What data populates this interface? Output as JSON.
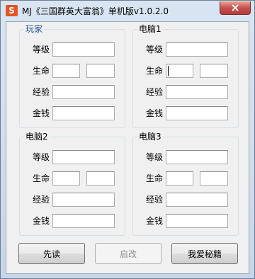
{
  "window": {
    "title": "MJ《三国群英大富翁》单机版v1.0.2.0",
    "icon": "app-logo-icon",
    "close_icon": "close-icon"
  },
  "labels": {
    "level": "等级",
    "life": "生命",
    "exp": "经验",
    "money": "金钱"
  },
  "groups": [
    {
      "title": "玩家"
    },
    {
      "title": "电脑1"
    },
    {
      "title": "电脑2"
    },
    {
      "title": "电脑3"
    }
  ],
  "fields": {
    "player": {
      "level": "",
      "life_current": "",
      "life_max": "",
      "exp": "",
      "money": ""
    },
    "computer1": {
      "level": "",
      "life_current": "",
      "life_max": "",
      "exp": "",
      "money": ""
    },
    "computer2": {
      "level": "",
      "life_current": "",
      "life_max": "",
      "exp": "",
      "money": ""
    },
    "computer3": {
      "level": "",
      "life_current": "",
      "life_max": "",
      "exp": "",
      "money": ""
    }
  },
  "buttons": {
    "read": "先读",
    "start": "启改",
    "cheats": "我爱秘籍"
  },
  "colors": {
    "group_title_active": "#1e4fa0",
    "close_button": "#c75050",
    "icon_bg": "#e8531f"
  }
}
